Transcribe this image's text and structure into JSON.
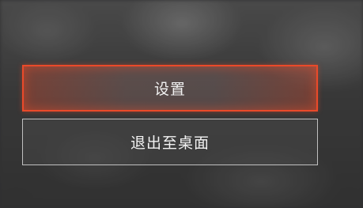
{
  "menu": {
    "settings_label": "设置",
    "exit_label": "退出至桌面"
  },
  "colors": {
    "accent": "#ea4a2a",
    "button_border": "#d7d7d7",
    "label": "#f2f2f2"
  }
}
